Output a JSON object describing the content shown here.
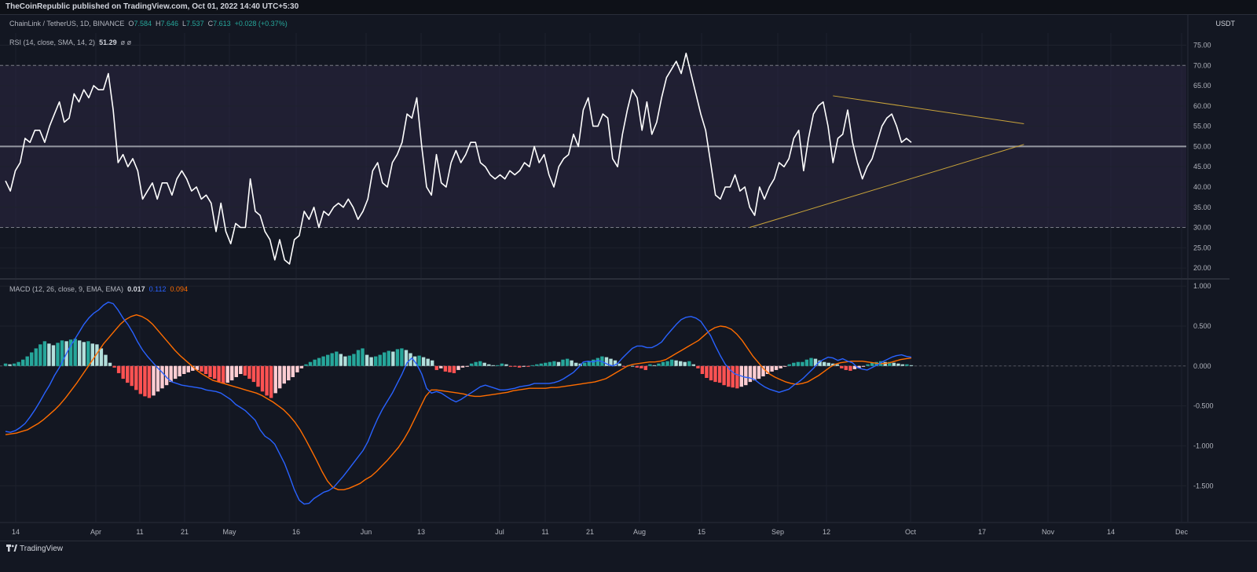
{
  "header": {
    "publisher_line": "TheCoinRepublic published on TradingView.com, Oct 01, 2022 14:40 UTC+5:30"
  },
  "symbol": {
    "name": "ChainLink / TetherUS, 1D, BINANCE",
    "o_label": "O",
    "o": "7.584",
    "h_label": "H",
    "h": "7.646",
    "l_label": "L",
    "l": "7.537",
    "c_label": "C",
    "c": "7.613",
    "change": "+0.028 (+0.37%)",
    "currency": "USDT"
  },
  "rsi_legend": {
    "label": "RSI (14, close, SMA, 14, 2)",
    "value": "51.29",
    "extra": "ø ø"
  },
  "macd_legend": {
    "label": "MACD (12, 26, close, 9, EMA, EMA)",
    "v1": "0.017",
    "v2": "0.112",
    "v3": "0.094"
  },
  "footer": {
    "brand": "TradingView"
  },
  "colors": {
    "bg": "#131722",
    "grid": "#1e222d",
    "rsi_line": "#ffffff",
    "rsi_band": "#2a2440",
    "midline": "#9598a1",
    "trendline": "#c9a43a",
    "macd": "#2962ff",
    "signal": "#ff6d00",
    "hist_up_strong": "#26a69a",
    "hist_up_weak": "#b2dfdb",
    "hist_down_strong": "#ff5252",
    "hist_down_weak": "#ffcdd2"
  },
  "chart_data": [
    {
      "type": "line",
      "name": "RSI",
      "x_ticks": [
        "14",
        "Apr",
        "11",
        "21",
        "May",
        "16",
        "Jun",
        "13",
        "Jul",
        "11",
        "21",
        "Aug",
        "15",
        "Sep",
        "12",
        "17",
        "Oct",
        "Nov",
        "14",
        "Dec"
      ],
      "y_ticks": [
        "75.00",
        "70.00",
        "65.00",
        "60.00",
        "55.00",
        "50.00",
        "45.00",
        "40.00",
        "35.00",
        "30.00",
        "25.00",
        "20.00"
      ],
      "ylim": [
        17.5,
        78
      ],
      "bands": {
        "upper": 70,
        "lower": 30,
        "mid": 50
      },
      "values": [
        41.5,
        39,
        44,
        46,
        52,
        51,
        54,
        54,
        51,
        55,
        58,
        61,
        56,
        57,
        63,
        61,
        64,
        62,
        65,
        64,
        64,
        68,
        59,
        46,
        48,
        45,
        47,
        44,
        37,
        39,
        41,
        37,
        41,
        41,
        38,
        42,
        44,
        42,
        39,
        40,
        37,
        38,
        36,
        29,
        36,
        29,
        26,
        31,
        30,
        30,
        42,
        34,
        33,
        29,
        27,
        22,
        27,
        22,
        21,
        27,
        28,
        34,
        32,
        35,
        30,
        34,
        33,
        35,
        36,
        35,
        37,
        35,
        32,
        34,
        37,
        44,
        46,
        41,
        40,
        46,
        48,
        51,
        58,
        57,
        62,
        50,
        40,
        38,
        48,
        41,
        40,
        46,
        49,
        46,
        48,
        51,
        51,
        46,
        45,
        43,
        42,
        43,
        42,
        44,
        43,
        44,
        46,
        45,
        50,
        46,
        48,
        43,
        40,
        45,
        47,
        48,
        53,
        50,
        59,
        62,
        55,
        55,
        58,
        57,
        47,
        45,
        53,
        59,
        64,
        62,
        54,
        61,
        53,
        56,
        62,
        67,
        69,
        71,
        68,
        73,
        68,
        63,
        58,
        54,
        46,
        38,
        37,
        40,
        40,
        43,
        39,
        40,
        35,
        33,
        40,
        37,
        40,
        42,
        46,
        45,
        47,
        52,
        54,
        44,
        52,
        58,
        60,
        61,
        55,
        46,
        52,
        53,
        59,
        51,
        46,
        42,
        45,
        47,
        51,
        55,
        57,
        58,
        55,
        51,
        52,
        51
      ],
      "trendlines": [
        {
          "from": [
            152,
            30
          ],
          "to": [
            208,
            50.5
          ]
        },
        {
          "from": [
            169,
            62.5
          ],
          "to": [
            208,
            55.6
          ]
        }
      ]
    },
    {
      "type": "line",
      "name": "MACD",
      "y_ticks": [
        "1.000",
        "0.500",
        "0.000",
        "-0.500",
        "-1.000",
        "-1.500"
      ],
      "ylim": [
        -1.95,
        1.08
      ],
      "macd": [
        -0.82,
        -0.83,
        -0.81,
        -0.77,
        -0.72,
        -0.64,
        -0.55,
        -0.45,
        -0.34,
        -0.24,
        -0.12,
        -0.02,
        0.1,
        0.22,
        0.32,
        0.42,
        0.52,
        0.6,
        0.66,
        0.7,
        0.76,
        0.8,
        0.78,
        0.7,
        0.6,
        0.52,
        0.42,
        0.3,
        0.2,
        0.12,
        0.05,
        -0.02,
        -0.08,
        -0.15,
        -0.2,
        -0.22,
        -0.24,
        -0.25,
        -0.26,
        -0.27,
        -0.28,
        -0.3,
        -0.31,
        -0.32,
        -0.34,
        -0.38,
        -0.42,
        -0.48,
        -0.52,
        -0.56,
        -0.62,
        -0.68,
        -0.8,
        -0.88,
        -0.92,
        -0.98,
        -1.1,
        -1.22,
        -1.38,
        -1.55,
        -1.68,
        -1.73,
        -1.72,
        -1.66,
        -1.62,
        -1.58,
        -1.56,
        -1.52,
        -1.45,
        -1.38,
        -1.3,
        -1.22,
        -1.14,
        -1.06,
        -0.95,
        -0.8,
        -0.66,
        -0.54,
        -0.44,
        -0.34,
        -0.22,
        -0.1,
        0.04,
        0.1,
        0.02,
        -0.1,
        -0.28,
        -0.34,
        -0.32,
        -0.34,
        -0.38,
        -0.42,
        -0.45,
        -0.42,
        -0.38,
        -0.34,
        -0.3,
        -0.26,
        -0.24,
        -0.26,
        -0.28,
        -0.3,
        -0.3,
        -0.29,
        -0.28,
        -0.26,
        -0.25,
        -0.24,
        -0.22,
        -0.22,
        -0.22,
        -0.22,
        -0.21,
        -0.19,
        -0.16,
        -0.12,
        -0.08,
        -0.02,
        0.05,
        0.06,
        0.05,
        0.07,
        0.05,
        0.02,
        0.0,
        0.03,
        0.1,
        0.16,
        0.22,
        0.25,
        0.25,
        0.23,
        0.23,
        0.26,
        0.3,
        0.38,
        0.45,
        0.52,
        0.58,
        0.61,
        0.62,
        0.6,
        0.56,
        0.47,
        0.38,
        0.25,
        0.13,
        0.02,
        -0.05,
        -0.1,
        -0.12,
        -0.14,
        -0.15,
        -0.17,
        -0.22,
        -0.26,
        -0.29,
        -0.31,
        -0.33,
        -0.31,
        -0.29,
        -0.24,
        -0.2,
        -0.15,
        -0.09,
        -0.03,
        0.04,
        0.08,
        0.11,
        0.1,
        0.07,
        0.09,
        0.06,
        0.04,
        -0.02,
        -0.04,
        -0.05,
        -0.02,
        0.01,
        0.05,
        0.08,
        0.11,
        0.13,
        0.14,
        0.12,
        0.11
      ],
      "signal": [
        -0.86,
        -0.85,
        -0.84,
        -0.82,
        -0.8,
        -0.76,
        -0.72,
        -0.67,
        -0.61,
        -0.55,
        -0.48,
        -0.4,
        -0.31,
        -0.22,
        -0.12,
        -0.02,
        0.08,
        0.18,
        0.28,
        0.36,
        0.44,
        0.52,
        0.58,
        0.62,
        0.64,
        0.62,
        0.58,
        0.52,
        0.44,
        0.36,
        0.28,
        0.2,
        0.13,
        0.07,
        0.01,
        -0.05,
        -0.1,
        -0.14,
        -0.18,
        -0.2,
        -0.22,
        -0.24,
        -0.26,
        -0.28,
        -0.3,
        -0.32,
        -0.34,
        -0.37,
        -0.41,
        -0.45,
        -0.5,
        -0.55,
        -0.62,
        -0.7,
        -0.8,
        -0.92,
        -1.05,
        -1.18,
        -1.32,
        -1.44,
        -1.52,
        -1.55,
        -1.55,
        -1.53,
        -1.5,
        -1.47,
        -1.42,
        -1.38,
        -1.32,
        -1.25,
        -1.18,
        -1.1,
        -1.02,
        -0.92,
        -0.8,
        -0.66,
        -0.52,
        -0.38,
        -0.3,
        -0.3,
        -0.31,
        -0.32,
        -0.33,
        -0.34,
        -0.35,
        -0.37,
        -0.38,
        -0.38,
        -0.37,
        -0.36,
        -0.35,
        -0.34,
        -0.33,
        -0.31,
        -0.3,
        -0.29,
        -0.28,
        -0.28,
        -0.28,
        -0.28,
        -0.27,
        -0.27,
        -0.26,
        -0.25,
        -0.24,
        -0.23,
        -0.22,
        -0.21,
        -0.2,
        -0.18,
        -0.16,
        -0.12,
        -0.08,
        -0.04,
        0.0,
        0.02,
        0.03,
        0.04,
        0.05,
        0.05,
        0.06,
        0.08,
        0.12,
        0.16,
        0.2,
        0.24,
        0.28,
        0.32,
        0.38,
        0.44,
        0.48,
        0.5,
        0.49,
        0.46,
        0.4,
        0.32,
        0.22,
        0.12,
        0.04,
        -0.04,
        -0.1,
        -0.14,
        -0.17,
        -0.2,
        -0.22,
        -0.23,
        -0.22,
        -0.2,
        -0.16,
        -0.12,
        -0.07,
        -0.02,
        0.02,
        0.04,
        0.05,
        0.06,
        0.06,
        0.06,
        0.05,
        0.04,
        0.03,
        0.03,
        0.04,
        0.06,
        0.08,
        0.09,
        0.1
      ],
      "histogram": [
        0.03,
        0.02,
        0.03,
        0.05,
        0.08,
        0.12,
        0.17,
        0.22,
        0.27,
        0.31,
        0.28,
        0.26,
        0.29,
        0.32,
        0.31,
        0.33,
        0.34,
        0.32,
        0.3,
        0.31,
        0.28,
        0.27,
        0.22,
        0.14,
        0.04,
        -0.02,
        -0.09,
        -0.16,
        -0.21,
        -0.25,
        -0.3,
        -0.35,
        -0.38,
        -0.4,
        -0.37,
        -0.32,
        -0.28,
        -0.24,
        -0.2,
        -0.16,
        -0.13,
        -0.1,
        -0.08,
        -0.06,
        -0.05,
        -0.07,
        -0.1,
        -0.14,
        -0.16,
        -0.2,
        -0.22,
        -0.21,
        -0.18,
        -0.14,
        -0.1,
        -0.12,
        -0.16,
        -0.2,
        -0.26,
        -0.32,
        -0.37,
        -0.4,
        -0.34,
        -0.28,
        -0.22,
        -0.18,
        -0.14,
        -0.08,
        -0.03,
        0.02,
        0.05,
        0.08,
        0.1,
        0.12,
        0.14,
        0.16,
        0.18,
        0.15,
        0.12,
        0.13,
        0.15,
        0.2,
        0.22,
        0.14,
        0.11,
        0.12,
        0.14,
        0.17,
        0.19,
        0.18,
        0.21,
        0.22,
        0.2,
        0.16,
        0.12,
        0.13,
        0.11,
        0.09,
        0.07,
        -0.05,
        -0.03,
        -0.07,
        -0.08,
        -0.09,
        -0.05,
        -0.02,
        -0.01,
        0.03,
        0.05,
        0.06,
        0.04,
        0.02,
        0.01,
        0.01,
        0.03,
        0.02,
        -0.01,
        -0.01,
        -0.02,
        -0.01,
        -0.01,
        0.01,
        0.02,
        0.03,
        0.04,
        0.05,
        0.06,
        0.05,
        0.08,
        0.09,
        0.07,
        0.04,
        0.03,
        0.04,
        0.06,
        0.08,
        0.1,
        0.12,
        0.11,
        0.09,
        0.07,
        0.03,
        -0.01,
        0.01,
        0.0,
        -0.02,
        -0.03,
        -0.05,
        0.02,
        0.01,
        0.03,
        0.05,
        0.06,
        0.08,
        0.07,
        0.06,
        0.05,
        0.06,
        0.02,
        -0.03,
        -0.1,
        -0.15,
        -0.18,
        -0.2,
        -0.21,
        -0.24,
        -0.26,
        -0.27,
        -0.28,
        -0.26,
        -0.24,
        -0.2,
        -0.18,
        -0.16,
        -0.13,
        -0.1,
        -0.07,
        -0.05,
        -0.03,
        -0.01,
        0.02,
        0.04,
        0.05,
        0.05,
        0.08,
        0.1,
        0.09,
        0.07,
        0.05,
        0.04,
        0.03,
        0.02,
        -0.03,
        -0.05,
        -0.06,
        -0.04,
        -0.03,
        -0.01,
        0.02,
        0.04,
        0.05,
        0.06,
        0.05,
        0.05,
        0.04,
        0.03,
        0.02,
        0.02,
        0.01
      ]
    }
  ]
}
